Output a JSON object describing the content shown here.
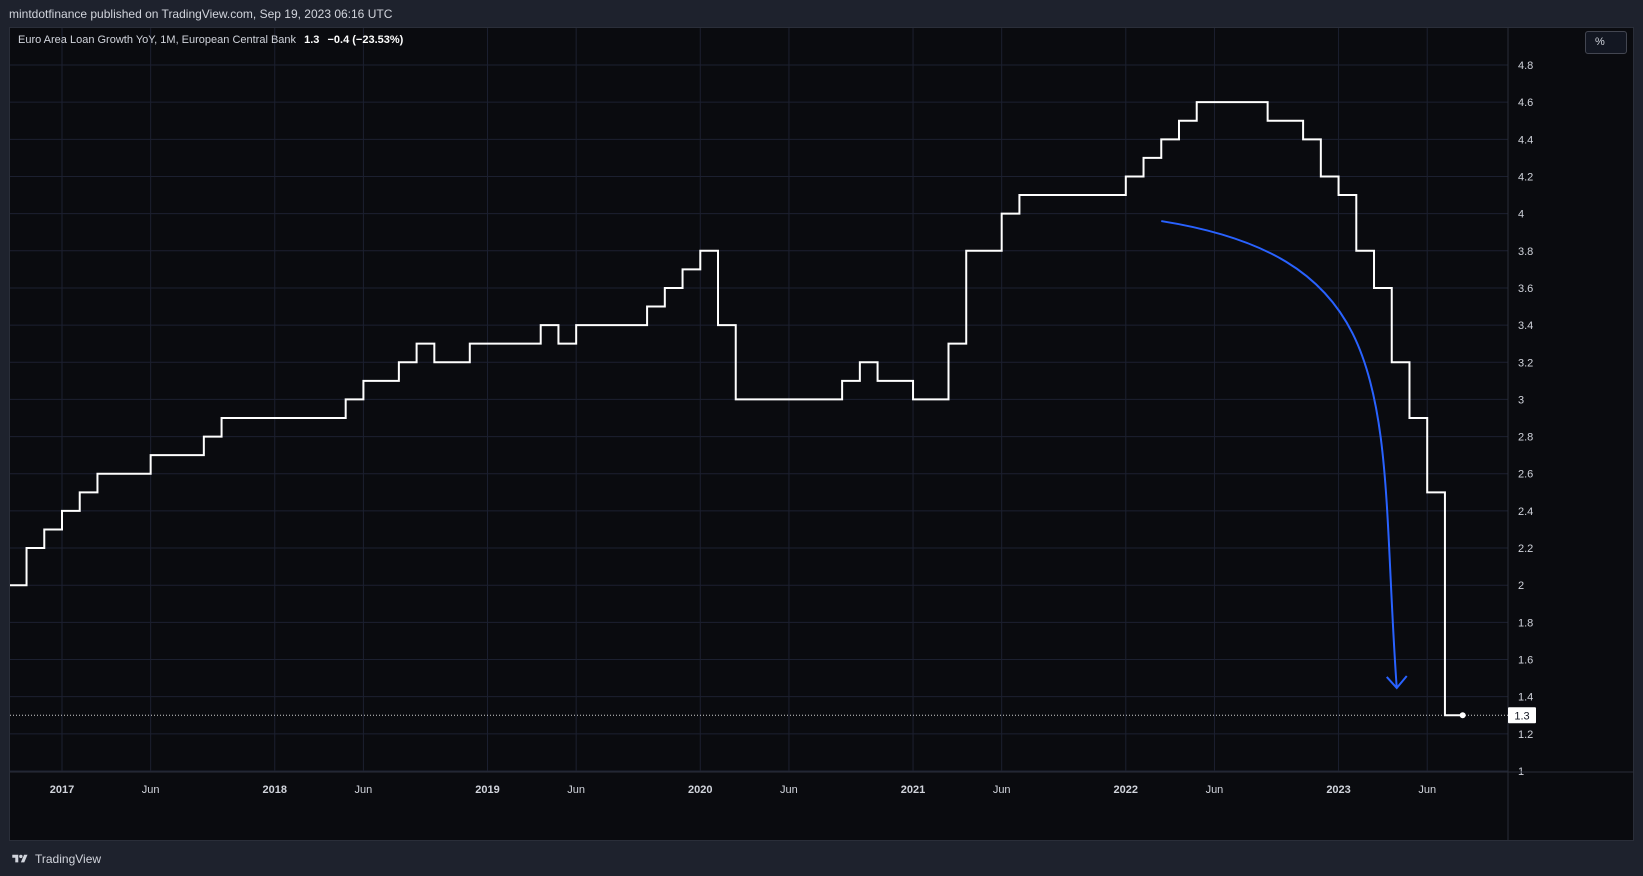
{
  "header": {
    "published_text": "mintdotfinance published on TradingView.com, Sep 19, 2023 06:16 UTC"
  },
  "legend": {
    "series_label": "Euro Area Loan Growth YoY, 1M, European Central Bank",
    "last_value": "1.3",
    "change": "−0.4 (−23.53%)"
  },
  "unit_button": {
    "label": "%"
  },
  "footer": {
    "brand": "TradingView"
  },
  "colors": {
    "background": "#0a0b0f",
    "line": "#ffffff",
    "arrow": "#2962ff",
    "grid": "#1c2030",
    "axis_text": "#d1d4dc"
  },
  "chart_data": {
    "type": "line",
    "step": true,
    "title": "Euro Area Loan Growth YoY, 1M, European Central Bank",
    "ylabel": "%",
    "ylim": [
      1,
      4.8
    ],
    "y_ticks": [
      "1",
      "1.2",
      "1.4",
      "1.6",
      "1.8",
      "2",
      "2.2",
      "2.4",
      "2.6",
      "2.8",
      "3",
      "3.2",
      "3.4",
      "3.6",
      "3.8",
      "4",
      "4.2",
      "4.4",
      "4.6",
      "4.8"
    ],
    "x_ticks": [
      {
        "label": "2017",
        "date": "2017-01"
      },
      {
        "label": "Jun",
        "date": "2017-06"
      },
      {
        "label": "2018",
        "date": "2018-01"
      },
      {
        "label": "Jun",
        "date": "2018-06"
      },
      {
        "label": "2019",
        "date": "2019-01"
      },
      {
        "label": "Jun",
        "date": "2019-06"
      },
      {
        "label": "2020",
        "date": "2020-01"
      },
      {
        "label": "Jun",
        "date": "2020-06"
      },
      {
        "label": "2021",
        "date": "2021-01"
      },
      {
        "label": "Jun",
        "date": "2021-06"
      },
      {
        "label": "2022",
        "date": "2022-01"
      },
      {
        "label": "Jun",
        "date": "2022-06"
      },
      {
        "label": "2023",
        "date": "2023-01"
      },
      {
        "label": "Jun",
        "date": "2023-06"
      }
    ],
    "last_value_label": "1.3",
    "series": [
      {
        "x": [
          "2016-09",
          "2016-10",
          "2016-11",
          "2016-12",
          "2017-01",
          "2017-02",
          "2017-03",
          "2017-04",
          "2017-05",
          "2017-06",
          "2017-07",
          "2017-08",
          "2017-09",
          "2017-10",
          "2017-11",
          "2017-12",
          "2018-01",
          "2018-02",
          "2018-03",
          "2018-04",
          "2018-05",
          "2018-06",
          "2018-07",
          "2018-08",
          "2018-09",
          "2018-10",
          "2018-11",
          "2018-12",
          "2019-01",
          "2019-02",
          "2019-03",
          "2019-04",
          "2019-05",
          "2019-06",
          "2019-07",
          "2019-08",
          "2019-09",
          "2019-10",
          "2019-11",
          "2019-12",
          "2020-01",
          "2020-02",
          "2020-03",
          "2020-04",
          "2020-05",
          "2020-06",
          "2020-07",
          "2020-08",
          "2020-09",
          "2020-10",
          "2020-11",
          "2020-12",
          "2021-01",
          "2021-02",
          "2021-03",
          "2021-04",
          "2021-05",
          "2021-06",
          "2021-07",
          "2021-08",
          "2021-09",
          "2021-10",
          "2021-11",
          "2021-12",
          "2022-01",
          "2022-02",
          "2022-03",
          "2022-04",
          "2022-05",
          "2022-06",
          "2022-07",
          "2022-08",
          "2022-09",
          "2022-10",
          "2022-11",
          "2022-12",
          "2023-01",
          "2023-02",
          "2023-03",
          "2023-04",
          "2023-05",
          "2023-06",
          "2023-07"
        ],
        "values": [
          1.9,
          1.9,
          2.0,
          2.2,
          2.3,
          2.4,
          2.5,
          2.6,
          2.6,
          2.6,
          2.7,
          2.7,
          2.7,
          2.8,
          2.9,
          2.9,
          2.9,
          2.9,
          2.9,
          2.9,
          2.9,
          3.0,
          3.1,
          3.1,
          3.2,
          3.3,
          3.2,
          3.2,
          3.3,
          3.3,
          3.3,
          3.3,
          3.4,
          3.3,
          3.4,
          3.4,
          3.4,
          3.4,
          3.5,
          3.6,
          3.7,
          3.8,
          3.4,
          3.0,
          3.0,
          3.0,
          3.0,
          3.0,
          3.0,
          3.1,
          3.2,
          3.1,
          3.1,
          3.0,
          3.0,
          3.3,
          3.8,
          3.8,
          4.0,
          4.1,
          4.1,
          4.1,
          4.1,
          4.1,
          4.1,
          4.2,
          4.3,
          4.4,
          4.5,
          4.6,
          4.6,
          4.6,
          4.6,
          4.5,
          4.5,
          4.4,
          4.2,
          4.1,
          3.8,
          3.6,
          3.2,
          2.9,
          2.5
        ]
      }
    ],
    "annotations": [
      {
        "type": "curved-arrow",
        "from": {
          "date": "2022-03",
          "value": 3.96
        },
        "to": {
          "date": "2023-04",
          "value": 1.42
        }
      }
    ]
  }
}
